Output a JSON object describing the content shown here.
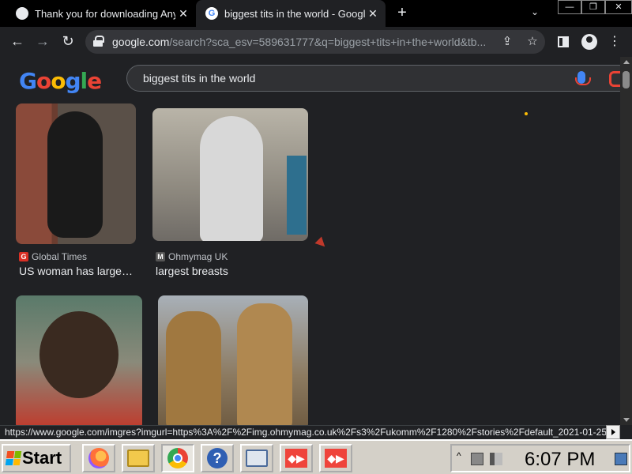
{
  "tabs": [
    {
      "title": "Thank you for downloading AnyD",
      "active": false
    },
    {
      "title": "biggest tits in the world - Google",
      "active": true
    }
  ],
  "new_tab_label": "+",
  "tab_dropdown": "⌄",
  "window_controls": {
    "minimize": "—",
    "restore": "❐",
    "close": "✕"
  },
  "toolbar": {
    "back": "←",
    "forward": "→",
    "reload": "↻",
    "url_host": "google.com",
    "url_rest": "/search?sca_esv=589631777&q=biggest+tits+in+the+world&tb...",
    "share_icon": "⇪",
    "star_icon": "☆",
    "menu_icon": "⋮"
  },
  "search": {
    "logo_letters": [
      "G",
      "o",
      "o",
      "g",
      "l",
      "e"
    ],
    "logo_colors": [
      "#4285f4",
      "#ea4335",
      "#fbbc05",
      "#4285f4",
      "#34a853",
      "#ea4335"
    ],
    "query": "biggest tits in the world"
  },
  "results": [
    {
      "source": "Global Times",
      "source_icon": "G",
      "source_icon_color": "#d93025",
      "caption": "US woman has large…"
    },
    {
      "source": "Ohmymag UK",
      "source_icon": "M",
      "source_icon_color": "#555555",
      "caption": "largest breasts"
    },
    {
      "source": "",
      "source_icon": "",
      "caption": ""
    },
    {
      "source": "",
      "source_icon": "",
      "caption": ""
    }
  ],
  "status_url": "https://www.google.com/imgres?imgurl=https%3A%2F%2Fimg.ohmymag.co.uk%2Fs3%2Fukomm%2F1280%2Fstories%2Fdefault_2021-01-25...",
  "taskbar": {
    "start_label": "Start",
    "apps": [
      "firefox-icon",
      "file-explorer-icon",
      "chrome-icon",
      "help-icon",
      "network-icon",
      "anydesk-icon",
      "anydesk-icon"
    ],
    "tray_arrow": "^",
    "clock": "6:07 PM"
  }
}
